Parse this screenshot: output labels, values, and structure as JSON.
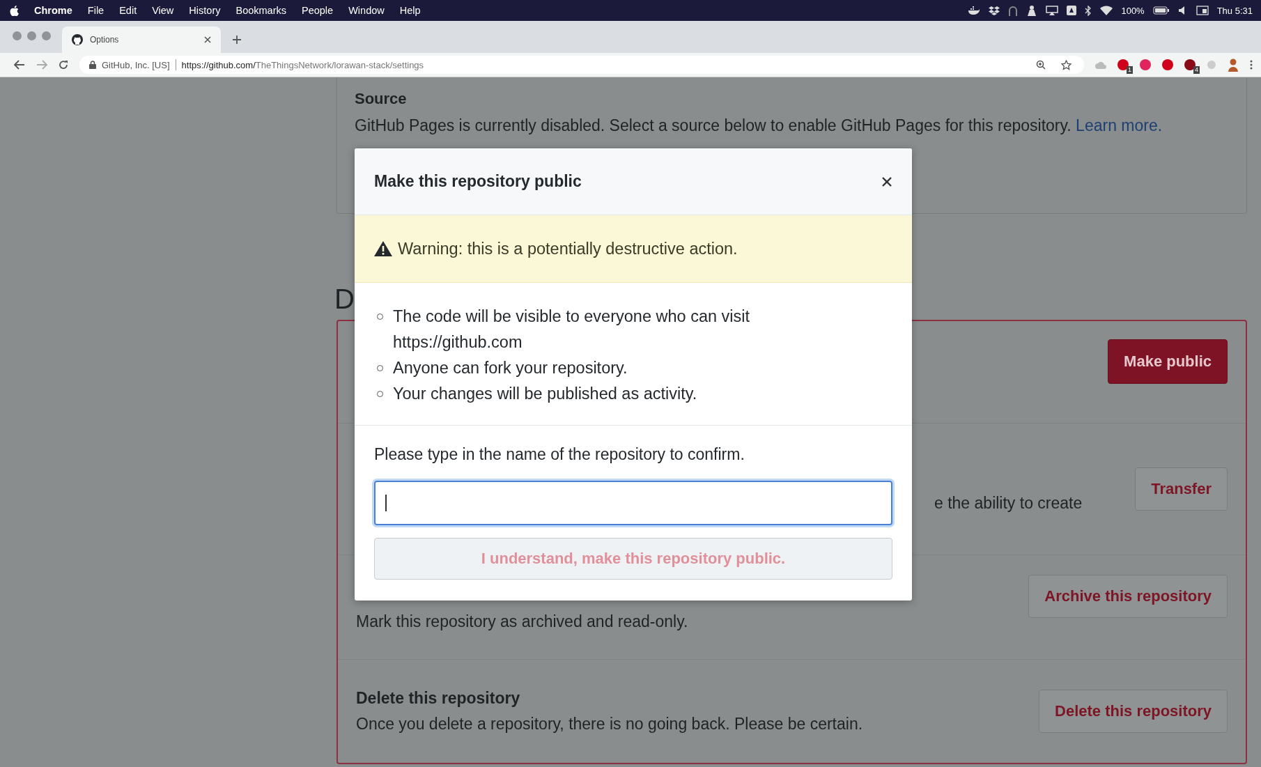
{
  "menu_bar": {
    "items": [
      {
        "label": "Chrome",
        "kind": "app"
      },
      {
        "label": "File",
        "kind": "menu"
      },
      {
        "label": "Edit",
        "kind": "menu"
      },
      {
        "label": "View",
        "kind": "menu"
      },
      {
        "label": "History",
        "kind": "menu"
      },
      {
        "label": "Bookmarks",
        "kind": "menu"
      },
      {
        "label": "People",
        "kind": "menu"
      },
      {
        "label": "Window",
        "kind": "menu"
      },
      {
        "label": "Help",
        "kind": "menu"
      }
    ],
    "battery": "100%",
    "clock": "Thu 5:31"
  },
  "tab": {
    "title": "Options"
  },
  "address_bar": {
    "security": "GitHub, Inc. [US]",
    "url_host": "https://github.com/",
    "url_path": "TheThingsNetwork/lorawan-stack/settings"
  },
  "extensions": [
    {
      "color": "#d0021b",
      "badge": "1"
    },
    {
      "color": "#e0245e"
    },
    {
      "color": "#d0021b"
    },
    {
      "color": "#8b0a1a",
      "badge": "4"
    }
  ],
  "source": {
    "title": "Source",
    "text": "GitHub Pages is currently disabled. Select a source below to enable GitHub Pages for this repository.",
    "link": "Learn more."
  },
  "danger_heading": "D",
  "danger_rows": [
    {
      "kind": "covered",
      "button": "Make public",
      "primary": true
    },
    {
      "kind": "partial",
      "text": "e the ability to create",
      "button": "Transfer",
      "primary": false
    },
    {
      "kind": "bottom",
      "text": "Mark this repository as archived and read-only.",
      "button": "Archive this repository",
      "primary": false
    },
    {
      "kind": "full",
      "title": "Delete this repository",
      "text": "Once you delete a repository, there is no going back. Please be certain.",
      "button": "Delete this repository",
      "primary": false
    }
  ],
  "dialog": {
    "title": "Make this repository public",
    "warning": "Warning: this is a potentially destructive action.",
    "points": [
      {
        "lines": [
          "The code will be visible to everyone who can visit",
          "https://github.com"
        ]
      },
      {
        "lines": [
          "Anyone can fork your repository."
        ]
      },
      {
        "lines": [
          "Your changes will be published as activity."
        ]
      }
    ],
    "confirm_label": "Please type in the name of the repository to confirm.",
    "input": {
      "focused": true
    },
    "submit": {
      "label": "I understand, make this repository public.",
      "disabled": true
    }
  }
}
